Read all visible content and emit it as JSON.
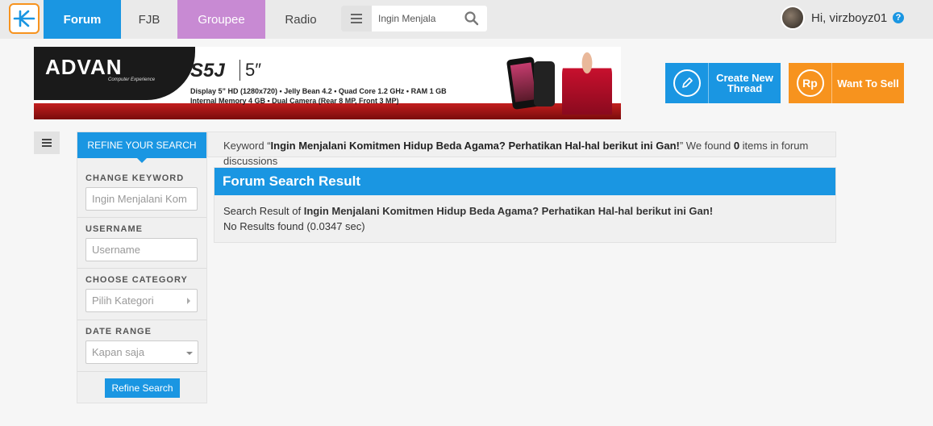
{
  "nav": {
    "tabs": [
      {
        "label": "Forum",
        "active": true
      },
      {
        "label": "FJB"
      },
      {
        "label": "Groupee"
      },
      {
        "label": "Radio"
      }
    ],
    "search_value": "Ingin Menjala",
    "user_greeting": "Hi, virzboyz01",
    "help_symbol": "?"
  },
  "banner": {
    "brand": "ADVAN",
    "brand_sub": "Computer Experience",
    "model": "S5J",
    "size": "5″",
    "spec_line1": "Display 5” HD (1280x720) • Jelly Bean 4.2 • Quad Core 1.2 GHz • RAM 1 GB",
    "spec_line2": "Internal Memory 4 GB • Dual Camera (Rear 8 MP, Front 3 MP)"
  },
  "actions": {
    "create_label": "Create New Thread",
    "sell_label": "Want To Sell",
    "sell_icon_text": "Rp"
  },
  "refine": {
    "tab_label": "REFINE YOUR SEARCH",
    "keyword_label": "CHANGE KEYWORD",
    "keyword_value": "Ingin Menjalani Kom",
    "username_label": "USERNAME",
    "username_placeholder": "Username",
    "category_label": "CHOOSE CATEGORY",
    "category_value": "Pilih Kategori",
    "date_label": "DATE RANGE",
    "date_value": "Kapan saja",
    "button_label": "Refine Search"
  },
  "summary": {
    "prefix": "Keyword “",
    "keyword": "Ingin Menjalani Komitmen Hidup Beda Agama? Perhatikan Hal-hal berikut ini Gan!",
    "middle": "” We found ",
    "count": "0",
    "suffix": " items in forum discussions"
  },
  "results": {
    "title": "Forum Search Result",
    "line1_prefix": "Search Result of ",
    "line1_query": "Ingin Menjalani Komitmen Hidup Beda Agama? Perhatikan Hal-hal berikut ini Gan!",
    "line2": "No Results found (0.0347 sec)"
  },
  "colors": {
    "primary": "#1a96e2",
    "groupee": "#c88ad3",
    "sell": "#f7931e",
    "logo_border": "#f7931e"
  },
  "icons": [
    "kaskus-logo-icon",
    "hamburger-icon",
    "search-icon",
    "help-icon",
    "pencil-icon",
    "rupiah-icon",
    "chevron-right-icon",
    "chevron-down-icon"
  ]
}
